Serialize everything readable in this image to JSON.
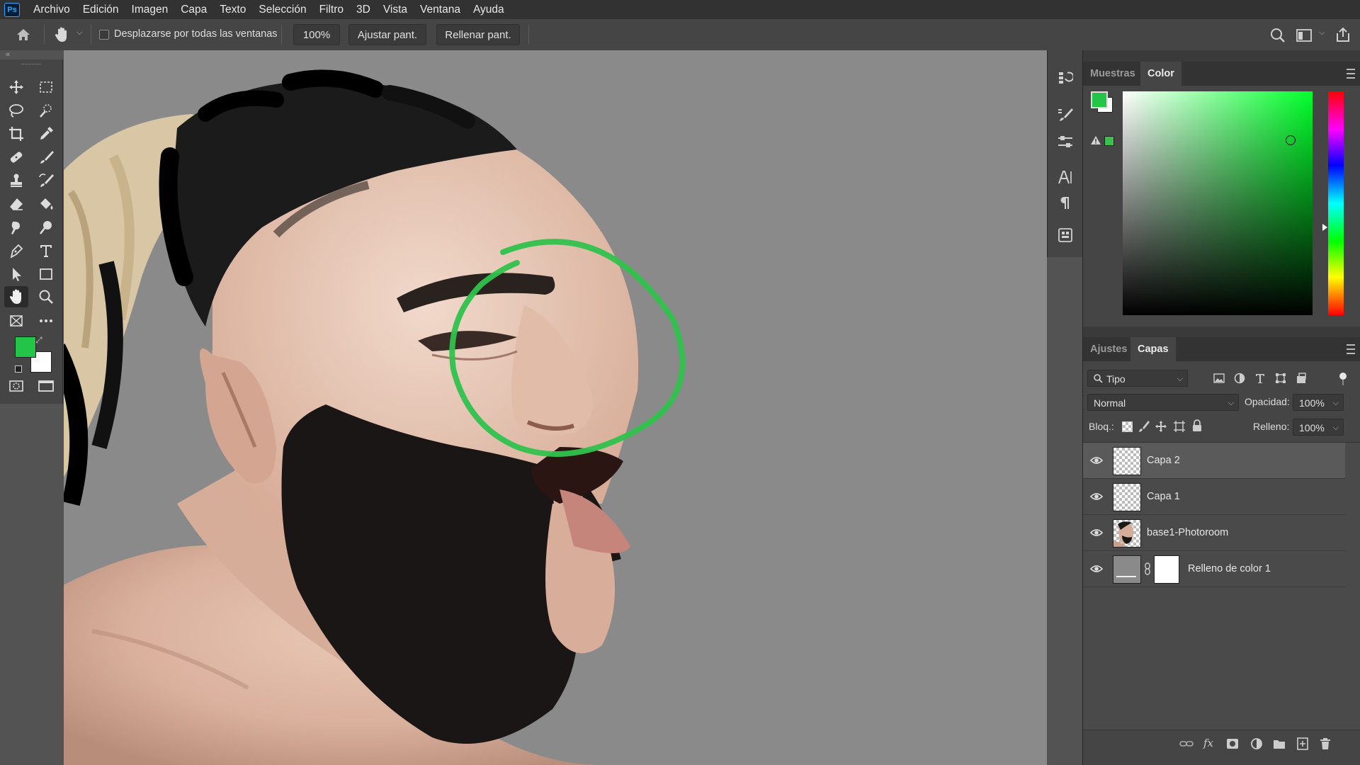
{
  "app": {
    "logo_text": "Ps"
  },
  "menu": [
    "Archivo",
    "Edición",
    "Imagen",
    "Capa",
    "Texto",
    "Selección",
    "Filtro",
    "3D",
    "Vista",
    "Ventana",
    "Ayuda"
  ],
  "options": {
    "scroll_all_label": "Desplazarse por todas las ventanas",
    "zoom_value": "100%",
    "fit_label": "Ajustar pant.",
    "fill_label": "Rellenar pant."
  },
  "colors": {
    "foreground": "#22c548",
    "background": "#ffffff",
    "brush_stroke": "#2fc24c"
  },
  "color_panel": {
    "tabs": [
      "Muestras",
      "Color"
    ],
    "active_tab": "Color"
  },
  "layers_panel": {
    "tabs": [
      "Ajustes",
      "Capas"
    ],
    "active_tab": "Capas",
    "filter_label": "Tipo",
    "blend_mode": "Normal",
    "opacity_label": "Opacidad:",
    "opacity_value": "100%",
    "lock_label": "Bloq.:",
    "fill_label": "Relleno:",
    "fill_value": "100%",
    "layers": [
      {
        "name": "Capa 2",
        "selected": true
      },
      {
        "name": "Capa 1",
        "selected": false
      },
      {
        "name": "base1-Photoroom",
        "selected": false
      },
      {
        "name": "Relleno de color 1",
        "selected": false
      }
    ]
  }
}
